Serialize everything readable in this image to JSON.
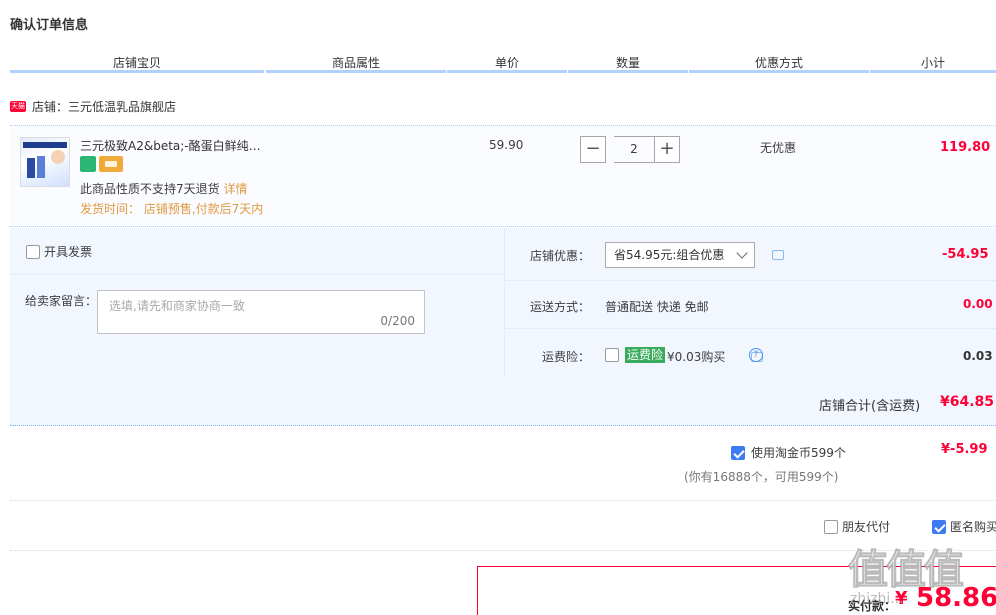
{
  "page": {
    "title": "确认订单信息"
  },
  "table_headers": [
    "店铺宝贝",
    "商品属性",
    "单价",
    "数量",
    "优惠方式",
    "小计"
  ],
  "shop": {
    "label": "店铺：三元低温乳品旗舰店",
    "tmall_badge": "天猫"
  },
  "item": {
    "name": "三元极致A2&beta;-酪蛋白鲜纯…",
    "no_return": "此商品性质不支持7天退货",
    "details_link": "详情",
    "ship_time": "发货时间：  店铺预售,付款后7天内",
    "unit_price": "59.90",
    "qty_minus": "−",
    "quantity": "2",
    "qty_plus": "+",
    "discount": "无优惠",
    "subtotal": "119.80"
  },
  "options": {
    "invoice_label": "开具发票",
    "message_label": "给卖家留言：",
    "message_placeholder": "选填,请先和商家协商一致",
    "message_count": "0/200",
    "shop_discount_label": "店铺优惠：",
    "shop_discount_select": "省54.95元:组合优惠",
    "shop_discount_value": "-54.95",
    "shipping_label": "运送方式：",
    "shipping_value": "普通配送 快递 免邮",
    "shipping_price": "0.00",
    "insurance_label": "运费险：",
    "insurance_tag": "运费险",
    "insurance_price": "¥0.03购买",
    "insurance_value": "0.03"
  },
  "shop_total": {
    "label": "店铺合计(含运费)",
    "value": "¥64.85"
  },
  "coins": {
    "label": "使用淘金币599个",
    "checked": true,
    "value": "¥-5.99",
    "note": "(你有16888个，可用599个)"
  },
  "extras": {
    "friend_pay": "朋友代付",
    "anonymous": "匿名购买"
  },
  "payment": {
    "label": "实付款：",
    "currency": "¥",
    "value": "58.86"
  },
  "watermark": {
    "text": "值值值",
    "site": "zhizhi..."
  }
}
